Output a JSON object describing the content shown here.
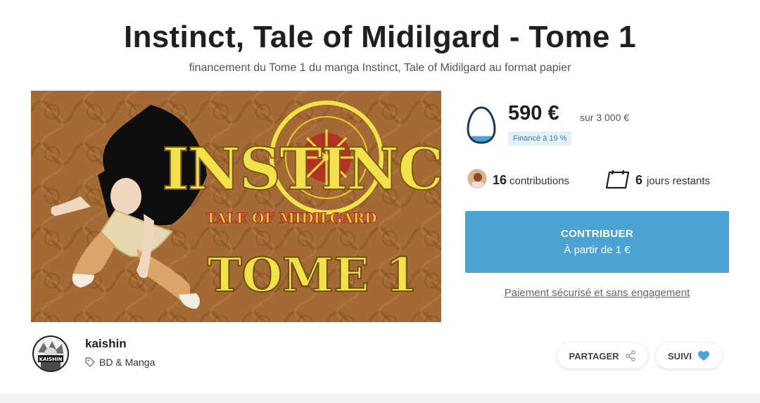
{
  "header": {
    "title": "Instinct, Tale of Midilgard - Tome 1",
    "subtitle": "financement du Tome 1 du manga Instinct, Tale of Midilgard au format papier"
  },
  "cover": {
    "logo_text": "INSTINCT",
    "tagline": "TALE OF MIDILGARD",
    "volume": "TOME 1"
  },
  "funding": {
    "amount": "590 €",
    "goal": "sur 3 000 €",
    "funded_label": "Financé à 19 %",
    "funded_fraction": 0.19
  },
  "stats": {
    "contributions_count": "16",
    "contributions_label": "contributions",
    "days_count": "6",
    "days_label": "jours restants"
  },
  "cta": {
    "label": "CONTRIBUER",
    "sublabel": "À partir de 1 €"
  },
  "secure_link": "Paiement sécurisé et sans engagement",
  "author": {
    "name": "kaishin",
    "category": "BD & Manga"
  },
  "actions": {
    "share_label": "PARTAGER",
    "follow_label": "SUIVI"
  },
  "colors": {
    "accent": "#4ba2d3",
    "badge_bg": "#e3f1f9",
    "cover_bg": "#a36a35",
    "logo_gold": "#f2e14a"
  }
}
